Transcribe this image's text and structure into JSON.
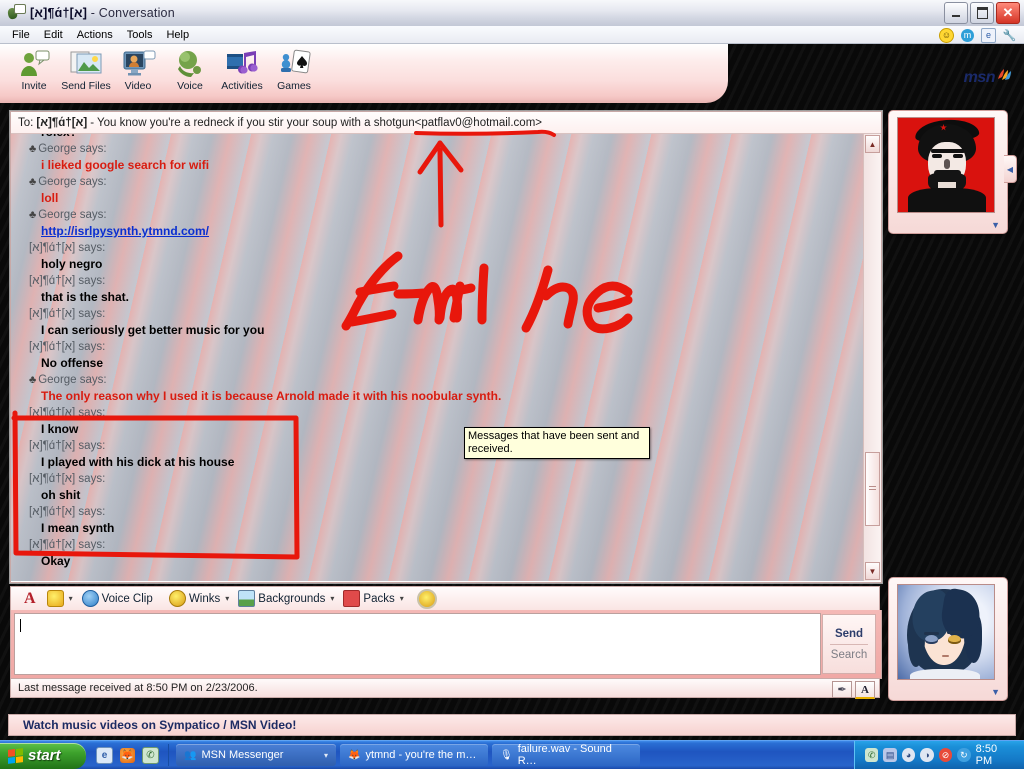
{
  "window": {
    "title_name": "[א]¶ɑ́†[א]",
    "title_suffix": " - Conversation",
    "app_icon": "messenger-icon",
    "minimize": "–",
    "maximize": "❐",
    "close": "✕"
  },
  "menu": {
    "items": [
      "File",
      "Edit",
      "Actions",
      "Tools",
      "Help"
    ],
    "tray_icons": [
      "smiley-icon",
      "msn-butterfly-icon",
      "ie-icon",
      "wrench-icon"
    ]
  },
  "toolbar": {
    "buttons": [
      {
        "label": "Invite",
        "icon": "invite-person-icon"
      },
      {
        "label": "Send Files",
        "icon": "send-files-icon"
      },
      {
        "label": "Video",
        "icon": "video-icon"
      },
      {
        "label": "Voice",
        "icon": "voice-headset-icon"
      },
      {
        "label": "Activities",
        "icon": "activities-music-icon"
      },
      {
        "label": "Games",
        "icon": "games-cards-icon"
      }
    ],
    "tab_icons": [
      "blocked-contact-icon",
      "handwrite-pen-icon"
    ],
    "brand": "msn"
  },
  "conversation": {
    "to_prefix": "To:",
    "to_name": "[א]¶ɑ́†[א]",
    "to_status": " - You know you're a redneck if you stir your soup with a shotgun ",
    "to_email": "<patflav0@hotmail.com>",
    "messages": [
      {
        "who": "",
        "bullet": false,
        "text": "rolex?",
        "style": "plain",
        "partial": true
      },
      {
        "who": "George says:",
        "bullet": true,
        "text": "i lieked google search for wifi",
        "style": "red"
      },
      {
        "who": "George says:",
        "bullet": true,
        "text": "loll",
        "style": "red"
      },
      {
        "who": "George says:",
        "bullet": true,
        "text": "http://isrlpysynth.ytmnd.com/",
        "style": "link"
      },
      {
        "who": "[א]¶ɑ́†[א] says:",
        "bullet": false,
        "text": "holy negro",
        "style": "plain"
      },
      {
        "who": "[א]¶ɑ́†[א] says:",
        "bullet": false,
        "text": "that is the shat.",
        "style": "plain"
      },
      {
        "who": "[א]¶ɑ́†[א] says:",
        "bullet": false,
        "text": "I can seriously get better music for you",
        "style": "plain"
      },
      {
        "who": "[א]¶ɑ́†[א] says:",
        "bullet": false,
        "text": "No offense",
        "style": "plain"
      },
      {
        "who": "George says:",
        "bullet": true,
        "text": "The only reason why I used it is because Arnold made it with his noobular synth.",
        "style": "red"
      },
      {
        "who": "[א]¶ɑ́†[א] says:",
        "bullet": false,
        "text": "I know",
        "style": "plain"
      },
      {
        "who": "[א]¶ɑ́†[א] says:",
        "bullet": false,
        "text": "I played with his dick at his house",
        "style": "plain"
      },
      {
        "who": "[א]¶ɑ́†[א] says:",
        "bullet": false,
        "text": "oh shit",
        "style": "plain"
      },
      {
        "who": "[א]¶ɑ́†[א] says:",
        "bullet": false,
        "text": "I mean synth",
        "style": "plain"
      },
      {
        "who": "[א]¶ɑ́†[א] says:",
        "bullet": false,
        "text": "Okay",
        "style": "plain"
      }
    ],
    "tooltip": "Messages that have been sent and received.",
    "scroll_up": "▲",
    "scroll_down": "▼"
  },
  "annotations": {
    "handwriting": "E-MAIL he",
    "arrow": "arrow-up-annotation",
    "underline": "email-underline-annotation",
    "box": "messages-box-annotation",
    "color": "#e8170c"
  },
  "format_bar": {
    "font_button": "A",
    "emoticon_button": "smiley-icon",
    "items": [
      {
        "label": "Voice Clip",
        "icon": "speaker-icon",
        "caret": true
      },
      {
        "label": "Winks",
        "icon": "wink-face-icon",
        "caret": true
      },
      {
        "label": "Backgrounds",
        "icon": "picture-icon",
        "caret": true
      },
      {
        "label": "Packs",
        "icon": "gift-icon",
        "caret": true
      }
    ],
    "nudge": "nudge-icon"
  },
  "input": {
    "value": "",
    "placeholder": "",
    "send_label": "Send",
    "search_label": "Search"
  },
  "status": {
    "text": "Last message received at 8:50 PM on 2/23/2006.",
    "icons": [
      "handwriting-pen-icon",
      "font-A-icon"
    ]
  },
  "display_pictures": {
    "contact": {
      "name": "che-guevara-avatar",
      "caret": "▼",
      "side_caret": "◀"
    },
    "self": {
      "name": "anime-girl-avatar",
      "caret": "▼"
    }
  },
  "ad": {
    "text": "Watch music videos on Sympatico / MSN Video!"
  },
  "taskbar": {
    "start_label": "start",
    "quick_launch": [
      "ie-icon",
      "firefox-icon",
      "messenger-icon"
    ],
    "tasks": [
      {
        "label": "MSN Messenger",
        "icon": "messenger-icon",
        "active": true,
        "caret": "▾"
      },
      {
        "label": "ytmnd - you're the m…",
        "icon": "firefox-icon",
        "active": false
      },
      {
        "label": "failure.wav - Sound R…",
        "icon": "sound-recorder-icon",
        "active": false
      }
    ],
    "tray_icons": [
      "messenger-tray-icon",
      "network-icon",
      "volume-icon",
      "shield-icon",
      "blocked-icon",
      "update-icon"
    ],
    "clock": "8:50 PM"
  }
}
